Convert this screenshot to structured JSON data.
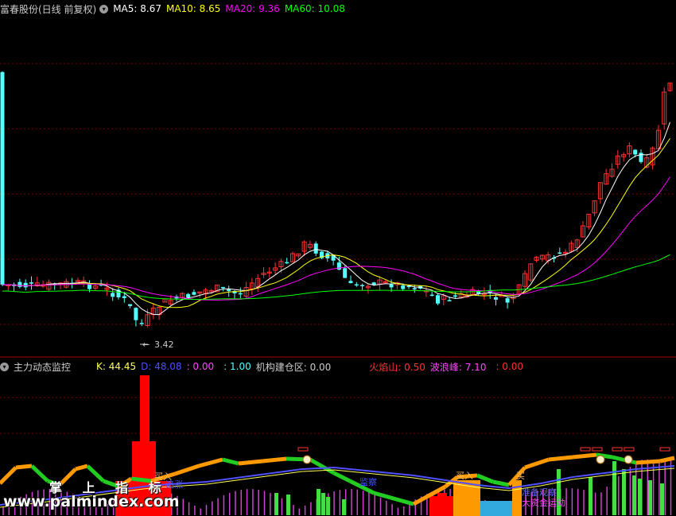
{
  "header": {
    "title": "富春股份(日线 前复权)",
    "ma": [
      {
        "label": "MA5: 8.67",
        "color": "#ffffff"
      },
      {
        "label": "MA10: 8.65",
        "color": "#ffff00"
      },
      {
        "label": "MA20: 9.36",
        "color": "#ff00ff"
      },
      {
        "label": "MA60: 10.08",
        "color": "#00ff00"
      }
    ]
  },
  "price_panel": {
    "low_marker": "3.42"
  },
  "indicator": {
    "title": "主力动态监控",
    "k": "K: 44.45",
    "d": "D: 48.08",
    "v1": ": 0.00",
    "v2": ": 1.00",
    "inst": "机构建仓区: 0.00",
    "fire": "火焰山: 0.50",
    "wave": "波浪峰: 7.10",
    "v3": ": 0.00",
    "labels": {
      "buy1": "买入",
      "buy2": "买入",
      "buy3": "买",
      "chase": "追涨",
      "observe": "监察",
      "watch": "准备观察",
      "main_force": "大资金运动"
    }
  },
  "watermark": {
    "line1": "掌 上 指 标",
    "line2": "www.palmindex.com"
  },
  "colors": {
    "up": "#ff3232",
    "down": "#54ffff",
    "grid": "#7a0000",
    "kline": "#ffff55",
    "dline": "#5050ff"
  }
}
